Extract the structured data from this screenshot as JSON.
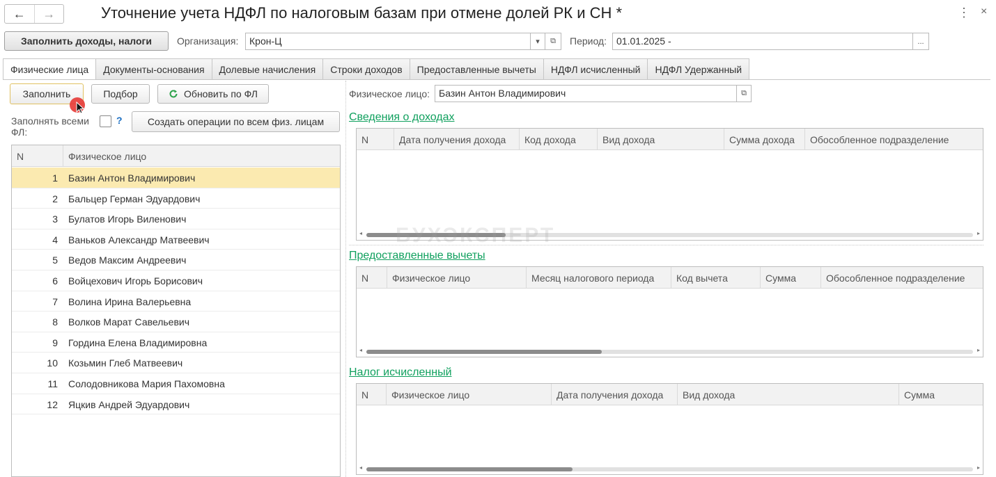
{
  "window": {
    "title": "Уточнение учета НДФЛ по налоговым базам при отмене долей РК и СН *",
    "back_icon": "←",
    "forward_icon": "→",
    "more_icon": "⋮",
    "close_icon": "×"
  },
  "toolbar": {
    "fill_income_label": "Заполнить доходы, налоги",
    "org_label": "Организация:",
    "org_value": "Крон-Ц",
    "period_label": "Период:",
    "period_value": "01.01.2025 -",
    "dropdown_icon": "▾",
    "open_icon": "⧉",
    "ellipsis_label": "..."
  },
  "tabs": [
    {
      "label": "Физические лица",
      "active": true
    },
    {
      "label": "Документы-основания",
      "active": false
    },
    {
      "label": "Долевые начисления",
      "active": false
    },
    {
      "label": "Строки доходов",
      "active": false
    },
    {
      "label": "Предоставленные вычеты",
      "active": false
    },
    {
      "label": "НДФЛ исчисленный",
      "active": false
    },
    {
      "label": "НДФЛ Удержанный",
      "active": false
    }
  ],
  "left": {
    "fill_label": "Заполнить",
    "select_label": "Подбор",
    "refresh_label": "Обновить по ФЛ",
    "fill_all_label_1": "Заполнять всеми",
    "fill_all_label_2": "ФЛ:",
    "help_label": "?",
    "create_ops_label": "Создать операции по всем физ. лицам",
    "columns": [
      "N",
      "Физическое лицо"
    ],
    "rows": [
      {
        "n": "1",
        "name": "Базин Антон Владимирович"
      },
      {
        "n": "2",
        "name": "Бальцер Герман Эдуардович"
      },
      {
        "n": "3",
        "name": "Булатов Игорь Виленович"
      },
      {
        "n": "4",
        "name": "Ваньков Александр Матвеевич"
      },
      {
        "n": "5",
        "name": "Ведов Максим Андреевич"
      },
      {
        "n": "6",
        "name": "Войцехович Игорь Борисович"
      },
      {
        "n": "7",
        "name": "Волина Ирина Валерьевна"
      },
      {
        "n": "8",
        "name": "Волков Марат Савельевич"
      },
      {
        "n": "9",
        "name": "Гордина Елена Владимировна"
      },
      {
        "n": "10",
        "name": "Козьмин Глеб Матвеевич"
      },
      {
        "n": "11",
        "name": "Солодовникова Мария Пахомовна"
      },
      {
        "n": "12",
        "name": "Яцкив Андрей Эдуардович"
      }
    ]
  },
  "right": {
    "person_label": "Физическое лицо:",
    "person_value": "Базин Антон Владимирович",
    "income": {
      "title": "Сведения о доходах",
      "columns": [
        "N",
        "Дата получения дохода",
        "Код дохода",
        "Вид дохода",
        "Сумма дохода",
        "Обособленное подразделение"
      ]
    },
    "deductions": {
      "title": "Предоставленные вычеты",
      "columns": [
        "N",
        "Физическое лицо",
        "Месяц налогового периода",
        "Код вычета",
        "Сумма",
        "Обособленное подразделение"
      ]
    },
    "tax": {
      "title": "Налог исчисленный",
      "columns": [
        "N",
        "Физическое лицо",
        "Дата получения дохода",
        "Вид дохода",
        "Сумма"
      ]
    }
  },
  "watermark": "БУХЭКСПЕРТ",
  "colors": {
    "accent_green": "#10a05e",
    "selected_row": "#fbeab0",
    "refresh_icon": "#2ca24a"
  }
}
